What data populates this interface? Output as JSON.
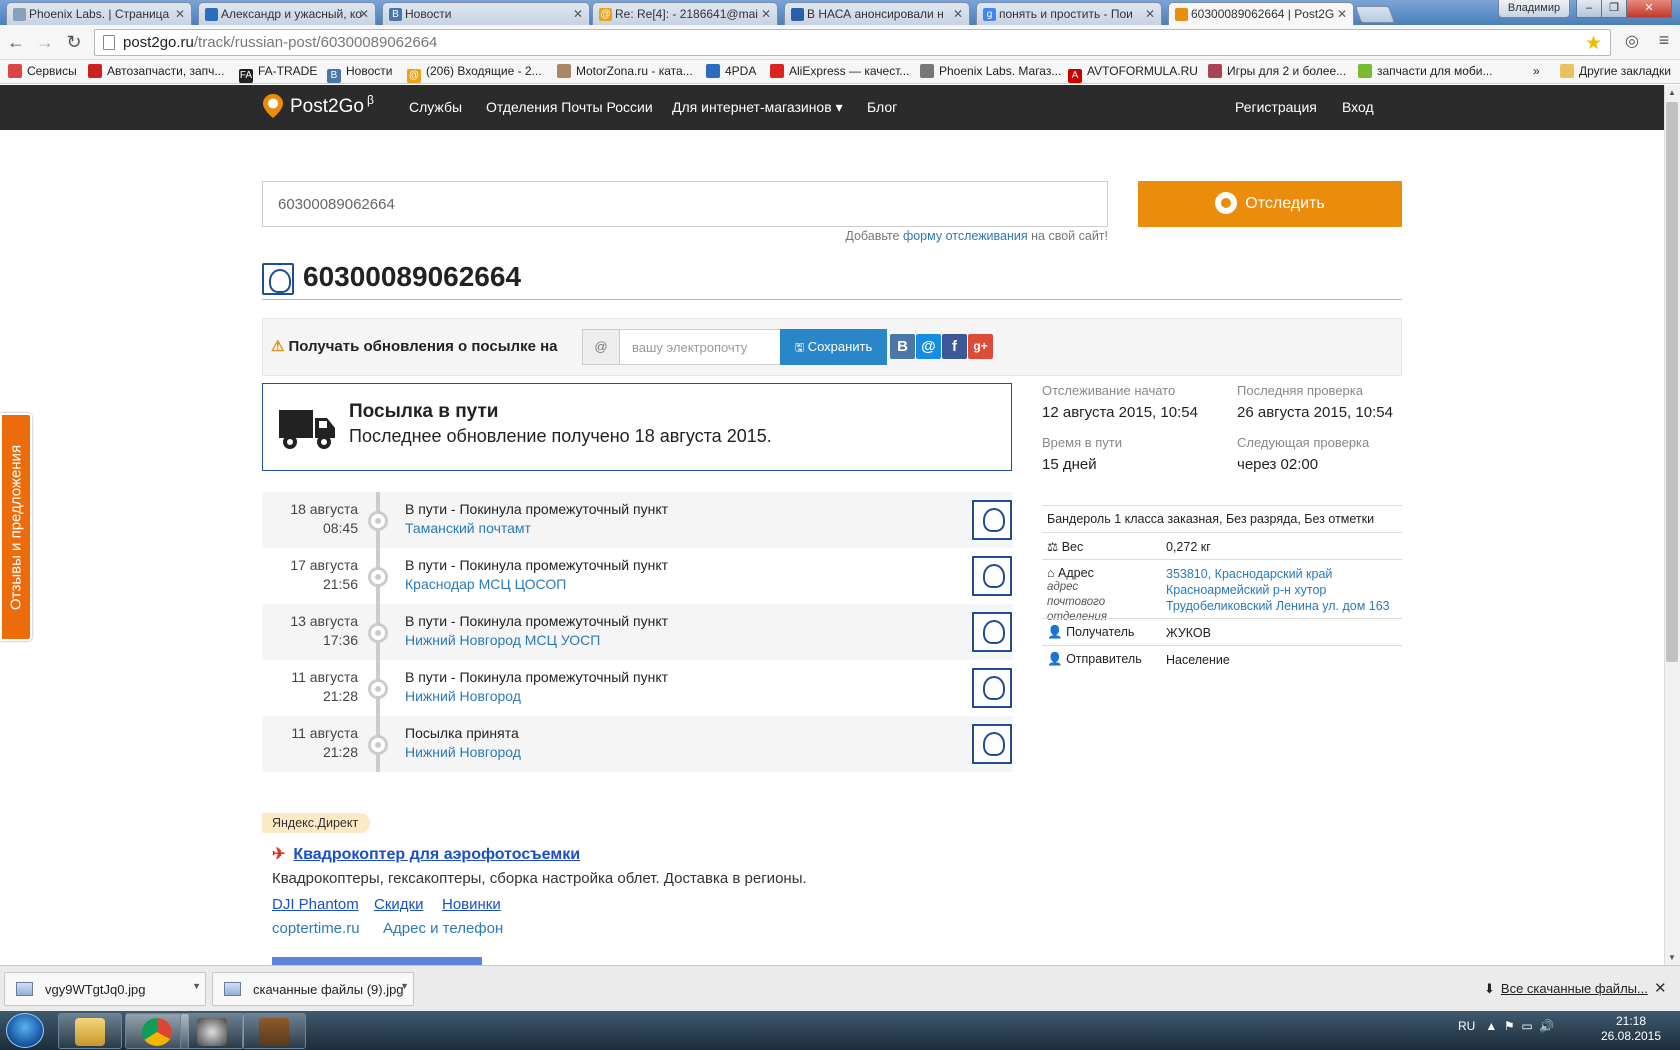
{
  "browser": {
    "tabs": [
      {
        "title": "Phoenix Labs. | Страница",
        "favicon_color": "#8aa0b8",
        "active": false
      },
      {
        "title": "Александр и ужасный, ко",
        "favicon_color": "#2a6fbd",
        "active": false
      },
      {
        "title": "Новости",
        "favicon_color": "#4a76a8",
        "active": false
      },
      {
        "title": "Re: Re[4]: - 2186641@mai",
        "favicon_color": "#e9a21b",
        "active": false
      },
      {
        "title": "В НАСА анонсировали н",
        "favicon_color": "#2b5ea8",
        "active": false
      },
      {
        "title": "понять и простить - Пои",
        "favicon_color": "#4285f4",
        "active": false
      },
      {
        "title": "60300089062664 | Post2G",
        "favicon_color": "#ec8c0c",
        "active": true
      }
    ],
    "user": "Владимир",
    "window_buttons": [
      "–",
      "❐",
      "✕"
    ],
    "nav": {
      "back": "←",
      "forward": "→",
      "reload": "↻"
    },
    "url_host": "post2go.ru",
    "url_path": "/track/russian-post/60300089062664",
    "bookmarks": [
      {
        "label": "Сервисы",
        "color": "#d44"
      },
      {
        "label": "Автозапчасти, запч...",
        "color": "#c22"
      },
      {
        "label": "FA-TRADE",
        "color": "#222"
      },
      {
        "label": "Новости",
        "color": "#4a76a8"
      },
      {
        "label": "(206) Входящие - 2...",
        "color": "#e9a21b"
      },
      {
        "label": "MotorZona.ru - ката...",
        "color": "#a86"
      },
      {
        "label": "4PDA",
        "color": "#2a6fbd"
      },
      {
        "label": "AliExpress — качест...",
        "color": "#d22"
      },
      {
        "label": "Phoenix Labs. Магаз...",
        "color": "#777"
      },
      {
        "label": "AVTOFORMULA.RU",
        "color": "#c00"
      },
      {
        "label": "Игры для 2 и более...",
        "color": "#a45"
      },
      {
        "label": "запчасти для моби...",
        "color": "#7b3"
      }
    ],
    "bookmarks_more": "»",
    "other_bookmarks": "Другие закладки"
  },
  "site": {
    "logo": "Post2Go",
    "logo_sup": "β",
    "nav": [
      "Службы",
      "Отделения Почты России",
      "Для интернет-магазинов",
      "Блог"
    ],
    "nav_caret": "▾",
    "auth": [
      "Регистрация",
      "Вход"
    ],
    "accent": "#ec8c0c"
  },
  "search": {
    "value": "60300089062664",
    "button": "Отследить",
    "hint_pre": "Добавьте ",
    "hint_link": "форму отслеживания",
    "hint_post": " на свой сайт!"
  },
  "tracking": {
    "number": "60300089062664",
    "notify_label": "Получать обновления о посылке на",
    "warn_icon": "⚠",
    "email_at": "@",
    "email_placeholder": "вашу электропочту",
    "save_button": "Сохранить",
    "save_icon": "🖫",
    "social": [
      {
        "glyph": "В",
        "color": "#4a76a8",
        "name": "vk"
      },
      {
        "glyph": "@",
        "color": "#168de2",
        "name": "mailru"
      },
      {
        "glyph": "f",
        "color": "#3b5998",
        "name": "facebook"
      },
      {
        "glyph": "g+",
        "color": "#dd4b39",
        "name": "googleplus"
      }
    ],
    "status_title": "Посылка в пути",
    "status_sub": "Последнее обновление получено 18 августа 2015.",
    "info": {
      "started_label": "Отслеживание начато",
      "started_value": "12 августа 2015, 10:54",
      "last_check_label": "Последняя проверка",
      "last_check_value": "26 августа 2015, 10:54",
      "in_transit_label": "Время в пути",
      "in_transit_value": "15 дней",
      "next_check_label": "Следующая проверка",
      "next_check_value": "через 02:00"
    },
    "events": [
      {
        "date": "18 августа",
        "time": "08:45",
        "action": "В пути - Покинула промежуточный пункт",
        "place": "Таманский почтамт"
      },
      {
        "date": "17 августа",
        "time": "21:56",
        "action": "В пути - Покинула промежуточный пункт",
        "place": "Краснодар МСЦ ЦОСОП"
      },
      {
        "date": "13 августа",
        "time": "17:36",
        "action": "В пути - Покинула промежуточный пункт",
        "place": "Нижний Новгород МСЦ УОСП"
      },
      {
        "date": "11 августа",
        "time": "21:28",
        "action": "В пути - Покинула промежуточный пункт",
        "place": "Нижний Новгород"
      },
      {
        "date": "11 августа",
        "time": "21:28",
        "action": "Посылка принята",
        "place": "Нижний Новгород"
      }
    ],
    "details": {
      "type": "Бандероль 1 класса заказная, Без разряда, Без отметки",
      "weight_label": "Вес",
      "weight_value": "0,272 кг",
      "address_label": "Адрес",
      "address_sub": "адрес почтового отделения",
      "address_l1": "353810, Краснодарский край",
      "address_l2": "Красноармейский р-н хутор",
      "address_l3": "Трудобеликовский Ленина ул. дом 163",
      "recipient_label": "Получатель",
      "recipient_value": "ЖУКОВ",
      "sender_label": "Отправитель",
      "sender_value": "Население"
    }
  },
  "ad": {
    "label": "Яндекс.Директ",
    "title": "Квадрокоптер для аэрофотосъемки",
    "text": "Квадрокоптеры, гексакоптеры, сборка настройка облет. Доставка в регионы.",
    "links": [
      "DJI Phantom",
      "Скидки",
      "Новинки"
    ],
    "domain": "coptertime.ru",
    "contact": "Адрес и телефон"
  },
  "feedback_tab": "Отзывы и предложения",
  "downloads": {
    "items": [
      "vgy9WTgtJq0.jpg",
      "скачанные файлы (9).jpg"
    ],
    "all": "Все скачанные файлы...",
    "close": "✕"
  },
  "taskbar": {
    "lang": "RU",
    "time": "21:18",
    "date": "26.08.2015"
  }
}
